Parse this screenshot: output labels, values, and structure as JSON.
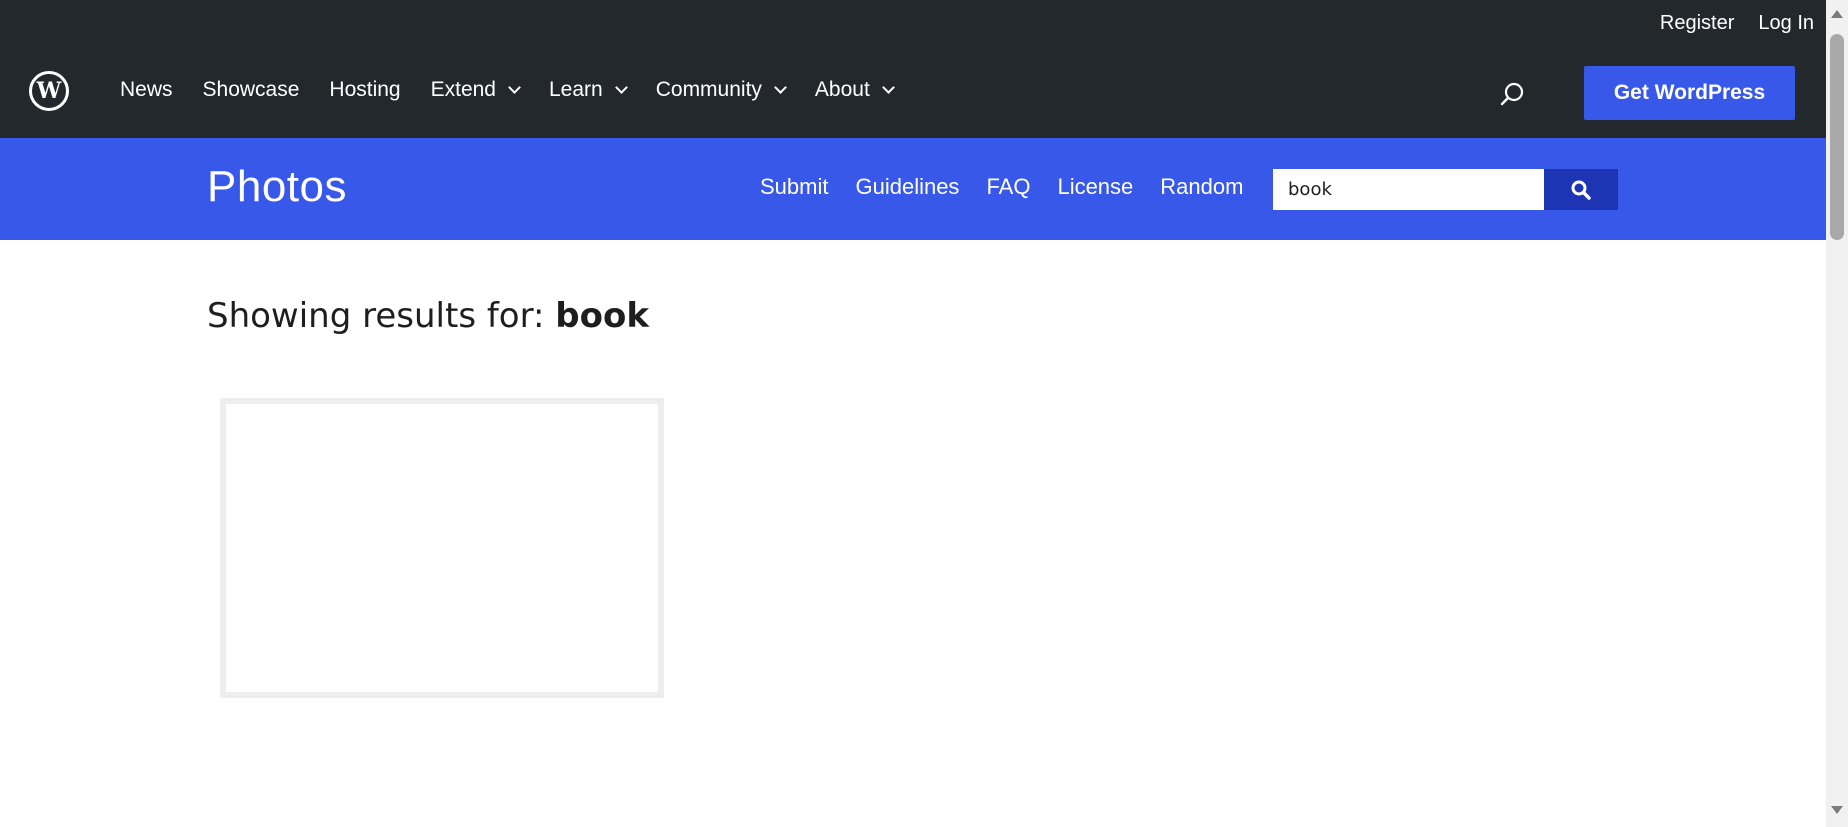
{
  "header": {
    "logo_icon": "wordpress-logo",
    "logo_glyph": "W",
    "top_links": [
      "Register",
      "Log In"
    ],
    "nav": [
      {
        "label": "News",
        "has_dropdown": false
      },
      {
        "label": "Showcase",
        "has_dropdown": false
      },
      {
        "label": "Hosting",
        "has_dropdown": false
      },
      {
        "label": "Extend",
        "has_dropdown": true
      },
      {
        "label": "Learn",
        "has_dropdown": true
      },
      {
        "label": "Community",
        "has_dropdown": true
      },
      {
        "label": "About",
        "has_dropdown": true
      }
    ],
    "search_icon": "search-icon",
    "cta_label": "Get WordPress"
  },
  "local_nav": {
    "title": "Photos",
    "links": [
      "Submit",
      "Guidelines",
      "FAQ",
      "License",
      "Random"
    ],
    "search_value": "book",
    "search_button_icon": "magnifier-icon"
  },
  "content": {
    "heading_prefix": "Showing results for: ",
    "query": "book"
  },
  "colors": {
    "header_bg": "#23282d",
    "accent_blue": "#3858e9",
    "search_button_bg": "#1d35b4"
  }
}
